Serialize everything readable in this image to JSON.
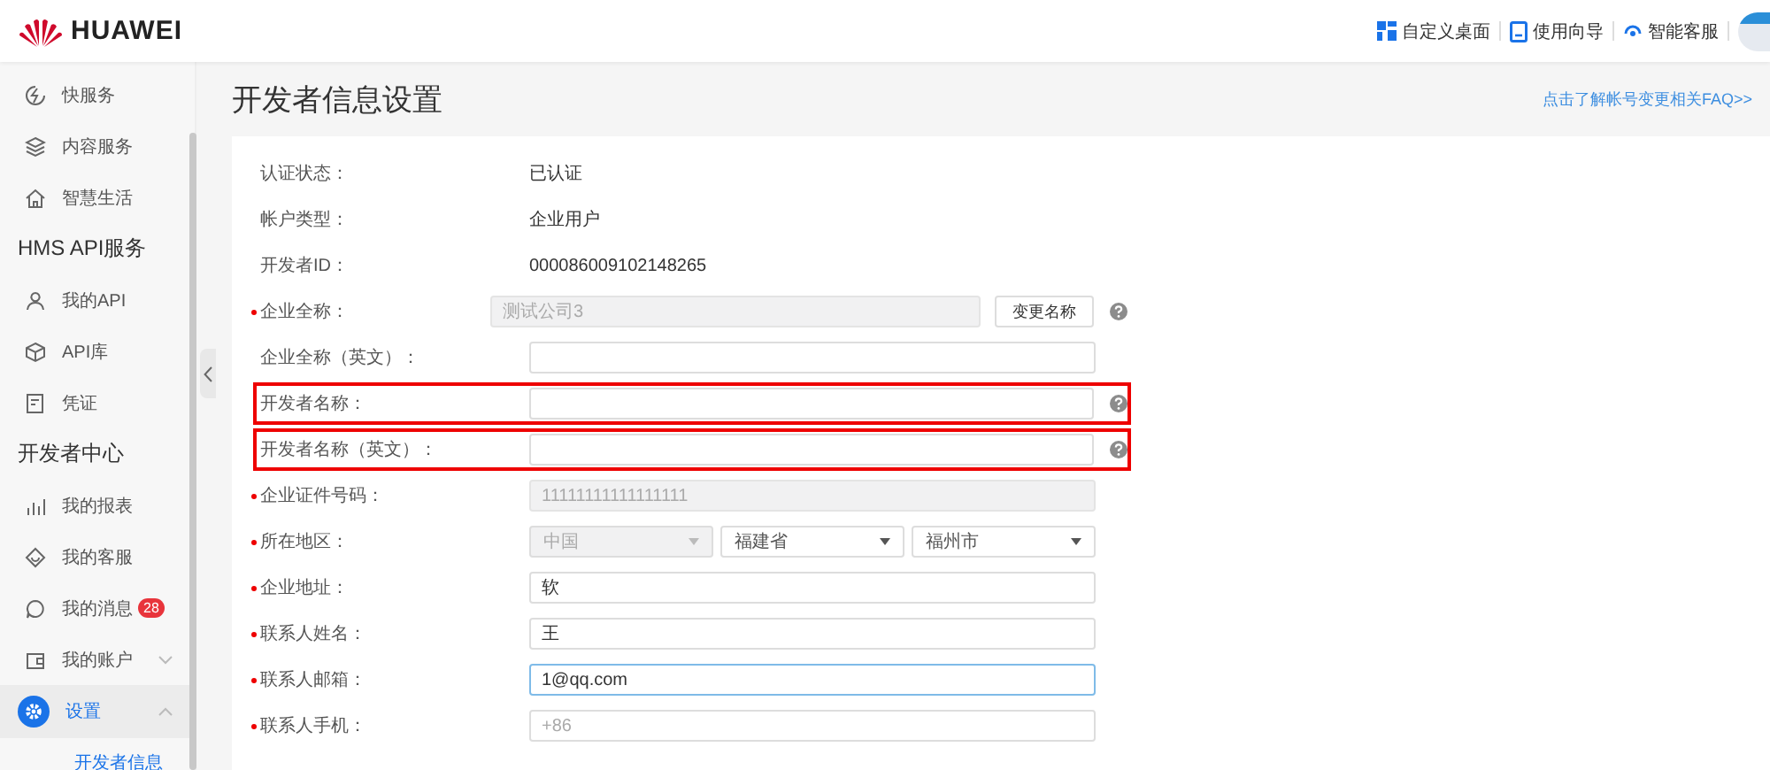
{
  "header": {
    "brand": "HUAWEI",
    "nav": [
      {
        "label": "自定义桌面"
      },
      {
        "label": "使用向导"
      },
      {
        "label": "智能客服"
      }
    ]
  },
  "sidebar": {
    "items": [
      {
        "kind": "item",
        "label": "快服务",
        "selected": false
      },
      {
        "kind": "item",
        "label": "内容服务",
        "selected": false
      },
      {
        "kind": "item",
        "label": "智慧生活",
        "selected": false
      },
      {
        "kind": "header",
        "label": "HMS API服务"
      },
      {
        "kind": "item",
        "label": "我的API",
        "selected": false
      },
      {
        "kind": "item",
        "label": "API库",
        "selected": false
      },
      {
        "kind": "item",
        "label": "凭证",
        "selected": false
      },
      {
        "kind": "header",
        "label": "开发者中心"
      },
      {
        "kind": "item",
        "label": "我的报表",
        "selected": false
      },
      {
        "kind": "item",
        "label": "我的客服",
        "selected": false
      },
      {
        "kind": "item",
        "label": "我的消息",
        "selected": false,
        "badge": "28"
      },
      {
        "kind": "item",
        "label": "我的账户",
        "selected": false,
        "expanded": false
      },
      {
        "kind": "item",
        "label": "设置",
        "selected": true,
        "expanded": true,
        "children": [
          {
            "label": "开发者信息",
            "selected": true
          }
        ]
      }
    ]
  },
  "page": {
    "title": "开发者信息设置",
    "faq_link": "点击了解帐号变更相关FAQ>>"
  },
  "form": [
    {
      "kind": "text",
      "label": "认证状态：",
      "required": false,
      "highlighted": false,
      "value": "已认证"
    },
    {
      "kind": "text",
      "label": "帐户类型：",
      "required": false,
      "highlighted": false,
      "value": "企业用户"
    },
    {
      "kind": "text",
      "label": "开发者ID：",
      "required": false,
      "highlighted": false,
      "value": "000086009102148265"
    },
    {
      "kind": "input",
      "label": "企业全称：",
      "required": true,
      "highlighted": false,
      "value": "测试公司3",
      "disabled": true,
      "focused": false,
      "help": true,
      "button": "变更名称"
    },
    {
      "kind": "input",
      "label": "企业全称（英文）：",
      "required": false,
      "highlighted": false,
      "disabled": false,
      "focused": false,
      "help": false
    },
    {
      "kind": "input",
      "label": "开发者名称：",
      "required": false,
      "highlighted": true,
      "disabled": false,
      "focused": false,
      "help": true
    },
    {
      "kind": "input",
      "label": "开发者名称（英文）：",
      "required": false,
      "highlighted": true,
      "disabled": false,
      "focused": false,
      "help": true
    },
    {
      "kind": "input",
      "label": "企业证件号码：",
      "required": true,
      "highlighted": false,
      "value": "11111111111111111",
      "disabled": true,
      "focused": false,
      "help": false
    },
    {
      "kind": "selects",
      "label": "所在地区：",
      "required": true,
      "highlighted": false,
      "selects": [
        {
          "value": "中国",
          "disabled": true
        },
        {
          "value": "福建省",
          "disabled": false
        },
        {
          "value": "福州市",
          "disabled": false
        }
      ]
    },
    {
      "kind": "input",
      "label": "企业地址：",
      "required": true,
      "highlighted": false,
      "value": "软",
      "disabled": false,
      "focused": false,
      "help": false
    },
    {
      "kind": "input",
      "label": "联系人姓名：",
      "required": true,
      "highlighted": false,
      "value": "王",
      "disabled": false,
      "focused": false,
      "help": false
    },
    {
      "kind": "input",
      "label": "联系人邮箱：",
      "required": true,
      "highlighted": false,
      "value": "1@qq.com",
      "disabled": false,
      "focused": true,
      "help": false
    },
    {
      "kind": "phone",
      "label": "联系人手机：",
      "required": true,
      "highlighted": false,
      "prefix": "+86"
    }
  ]
}
